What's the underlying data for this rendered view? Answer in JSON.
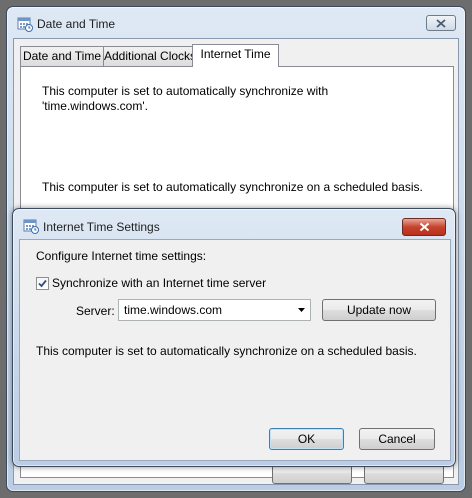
{
  "main_dialog": {
    "title": "Date and Time",
    "tabs": [
      {
        "label": "Date and Time",
        "selected": false
      },
      {
        "label": "Additional Clocks",
        "selected": false
      },
      {
        "label": "Internet Time",
        "selected": true
      }
    ],
    "panel_text_1": "This computer is set to automatically synchronize with",
    "panel_text_2": "'time.windows.com'.",
    "panel_text_3": "This computer is set to automatically synchronize on a scheduled basis."
  },
  "settings_dialog": {
    "title": "Internet Time Settings",
    "intro": "Configure Internet time settings:",
    "sync_checkbox": {
      "label": "Synchronize with an Internet time server",
      "checked": true
    },
    "server_label": "Server:",
    "server_value": "time.windows.com",
    "update_button": "Update now",
    "status_text": "This computer is set to automatically synchronize on a scheduled basis.",
    "ok_button": "OK",
    "cancel_button": "Cancel"
  },
  "icons": {
    "window_icon": "calendar-clock-icon",
    "close": "close-icon",
    "dropdown": "chevron-down-icon",
    "check": "checkmark-icon"
  },
  "colors": {
    "close_active": "#c6432d",
    "default_button_border": "#3c7fb1"
  }
}
